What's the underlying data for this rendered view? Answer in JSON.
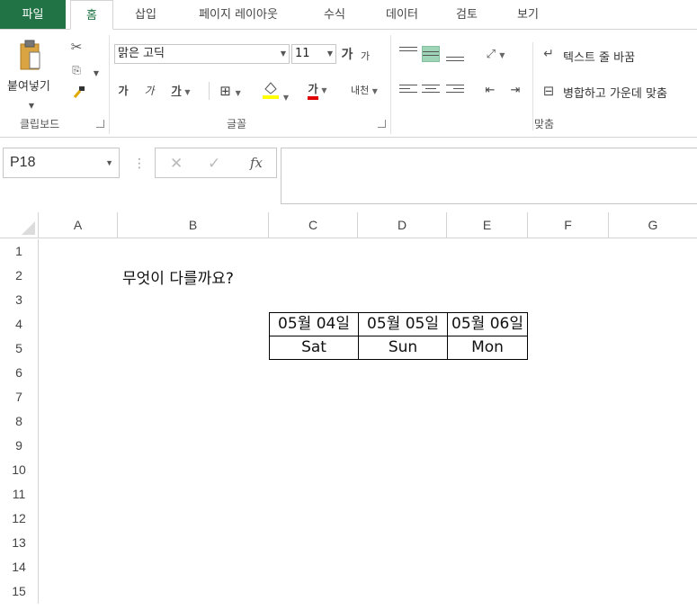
{
  "ribbon": {
    "tabs": [
      "파일",
      "홈",
      "삽입",
      "페이지 레이아웃",
      "수식",
      "데이터",
      "검토",
      "보기"
    ],
    "active_tab": "홈",
    "clipboard": {
      "paste_label": "붙여넣기",
      "group_label": "클립보드"
    },
    "font": {
      "font_name": "맑은 고딕",
      "font_size": "11",
      "grow_label": "가",
      "shrink_label": "가",
      "bold_label": "가",
      "italic_label": "가",
      "underline_label": "가",
      "font_color_label": "가",
      "phonetic_label": "내천",
      "group_label": "글꼴"
    },
    "alignment": {
      "wrap_text_label": "텍스트 줄 바꿈",
      "merge_center_label": "병합하고 가운데 맞춤",
      "group_label": "맞춤"
    }
  },
  "formula_bar": {
    "name_box": "P18",
    "fx_label": "fx",
    "value": ""
  },
  "grid": {
    "columns": [
      "A",
      "B",
      "C",
      "D",
      "E",
      "F",
      "G"
    ],
    "rows": [
      "1",
      "2",
      "3",
      "4",
      "5",
      "6",
      "7",
      "8",
      "9",
      "10",
      "11",
      "12",
      "13",
      "14",
      "15"
    ],
    "cells": {
      "B2": "무엇이 다를까요?",
      "C4": "05월 04일",
      "D4": "05월 05일",
      "E4": "05월 06일",
      "C5": "Sat",
      "D5": "Sun",
      "E5": "Mon"
    }
  },
  "colors": {
    "excel_green": "#217346",
    "selected_align": "#9fd5b7",
    "font_color_bar": "#e00000",
    "fill_color_bar": "#ffff00"
  }
}
